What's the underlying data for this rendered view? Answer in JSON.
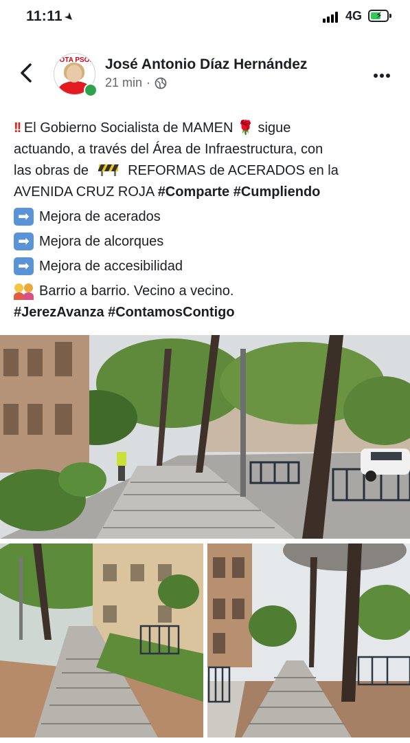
{
  "status_bar": {
    "time": "11:11",
    "network": "4G"
  },
  "post": {
    "author": "José Antonio Díaz Hernández",
    "time_ago": "21 min",
    "separator": "·",
    "avatar_text": "VOTA PSOE",
    "text": {
      "l1_a": "El Gobierno Socialista de MAMEN",
      "l1_b": "sigue",
      "l2": "actuando, a través del Área de Infraestructura,  con",
      "l3_a": "las obras de",
      "l3_b": "REFORMAS de ACERADOS en la",
      "l4_a": "AVENIDA CRUZ ROJA",
      "l4_tags": "#Comparte #Cumpliendo",
      "bullet1": "Mejora de acerados",
      "bullet2": "Mejora de alcorques",
      "bullet3": "Mejora de accesibilidad",
      "l8": "Barrio a barrio. Vecino a vecino.",
      "hashtags": "#JerezAvanza #ContamosContigo"
    },
    "icons": {
      "back": "back-chevron-icon",
      "privacy": "globe-icon",
      "more": "more-options-icon",
      "alert": "double-exclamation-icon",
      "rose": "rose-icon",
      "construction": "construction-barrier-icon",
      "arrow": "right-arrow-icon",
      "people": "family-icon"
    },
    "colors": {
      "online": "#31a24c",
      "arrow_box": "#5a93d6",
      "text": "#1c1e21",
      "meta": "#65676b"
    }
  }
}
